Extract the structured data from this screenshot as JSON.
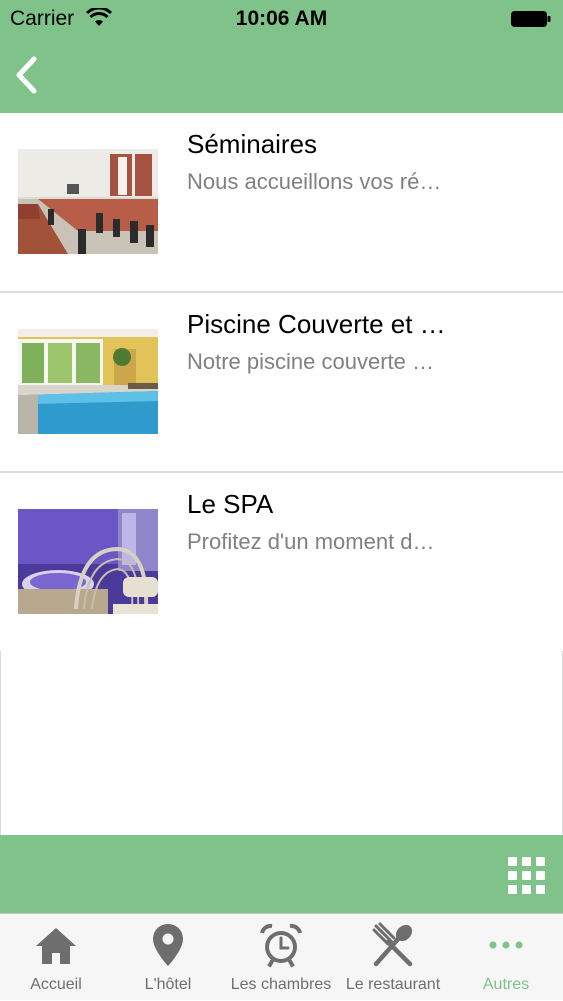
{
  "status_bar": {
    "carrier": "Carrier",
    "time": "10:06 AM",
    "icons": [
      "wifi-icon",
      "battery-icon"
    ]
  },
  "nav_bar": {
    "back_icon": "chevron-left-icon"
  },
  "items": [
    {
      "title": "Séminaires",
      "subtitle": "Nous accueillons vos ré…",
      "image": "seminar-room"
    },
    {
      "title": "Piscine Couverte et …",
      "subtitle": "Notre piscine couverte …",
      "image": "indoor-pool"
    },
    {
      "title": "Le SPA",
      "subtitle": "Profitez d'un moment d…",
      "image": "spa-jacuzzi"
    }
  ],
  "bottom_bar": {
    "icon": "grid-icon"
  },
  "tabs": [
    {
      "label": "Accueil",
      "icon": "home-icon",
      "active": false
    },
    {
      "label": "L'hôtel",
      "icon": "map-pin-icon",
      "active": false
    },
    {
      "label": "Les chambres",
      "icon": "alarm-clock-icon",
      "active": false
    },
    {
      "label": "Le restaurant",
      "icon": "fork-spoon-icon",
      "active": false
    },
    {
      "label": "Autres",
      "icon": "more-dots-icon",
      "active": true
    }
  ],
  "colors": {
    "accent": "#80c38a",
    "tab_inactive": "#6e6e6e",
    "subtitle": "#808080"
  }
}
